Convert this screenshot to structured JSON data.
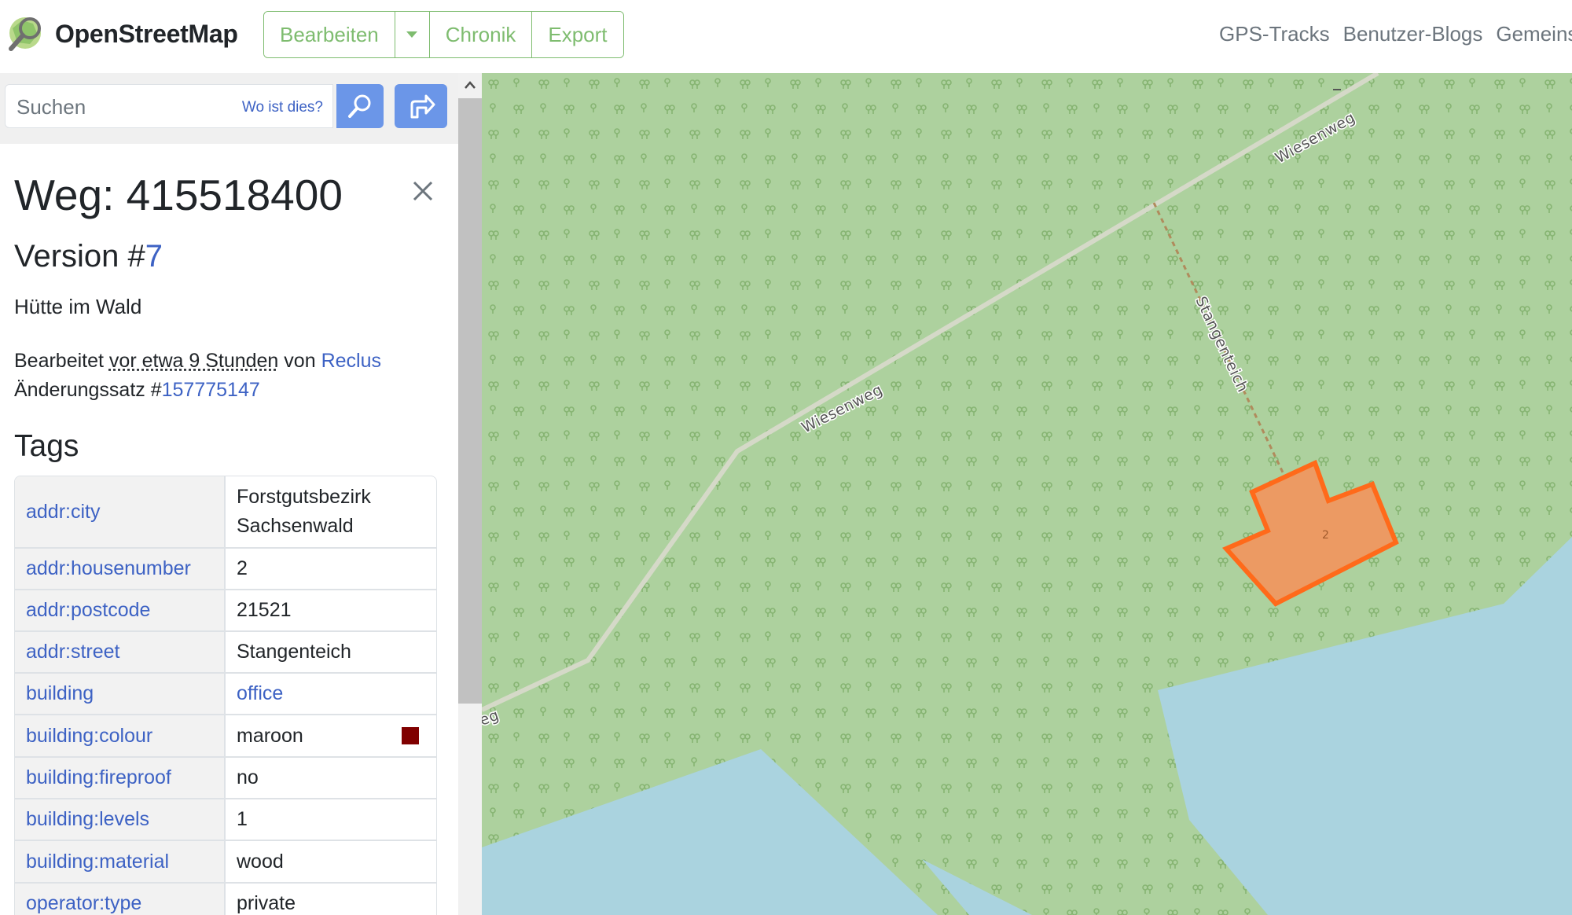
{
  "header": {
    "brand": "OpenStreetMap",
    "edit_label": "Bearbeiten",
    "history_label": "Chronik",
    "export_label": "Export",
    "nav": [
      "GPS-Tracks",
      "Benutzer-Blogs",
      "Gemeinscha"
    ]
  },
  "search": {
    "placeholder": "Suchen",
    "where_link": "Wo ist dies?"
  },
  "feature": {
    "title": "Weg: 415518400",
    "version_prefix": "Version #",
    "version_number": "7",
    "name": "Hütte im Wald",
    "edited_prefix": "Bearbeitet",
    "edited_time": "vor etwa 9 Stunden",
    "edited_by": "von",
    "editor": "Reclus",
    "changeset_prefix": "Änderungssatz #",
    "changeset_id": "157775147"
  },
  "tags": {
    "heading": "Tags",
    "rows": [
      {
        "key": "addr:city",
        "value": "Forstgutsbezirk Sachsenwald"
      },
      {
        "key": "addr:housenumber",
        "value": "2"
      },
      {
        "key": "addr:postcode",
        "value": "21521"
      },
      {
        "key": "addr:street",
        "value": "Stangenteich"
      },
      {
        "key": "building",
        "value": "office"
      },
      {
        "key": "building:colour",
        "value": "maroon"
      },
      {
        "key": "building:fireproof",
        "value": "no"
      },
      {
        "key": "building:levels",
        "value": "1"
      },
      {
        "key": "building:material",
        "value": "wood"
      },
      {
        "key": "operator:type",
        "value": "private"
      }
    ]
  },
  "map": {
    "labels": {
      "road_top": "Wiesenweg",
      "road_mid": "Wiesenweg",
      "road_left": "eg",
      "path": "Stangenteich",
      "housenumber": "2"
    }
  },
  "colors": {
    "forest": "#add19e",
    "water": "#aad3df",
    "highlight": "#ff6a1a",
    "building_swatch": "#800000",
    "osm_green": "#7ebc6f",
    "link_blue": "#3d62c4"
  }
}
